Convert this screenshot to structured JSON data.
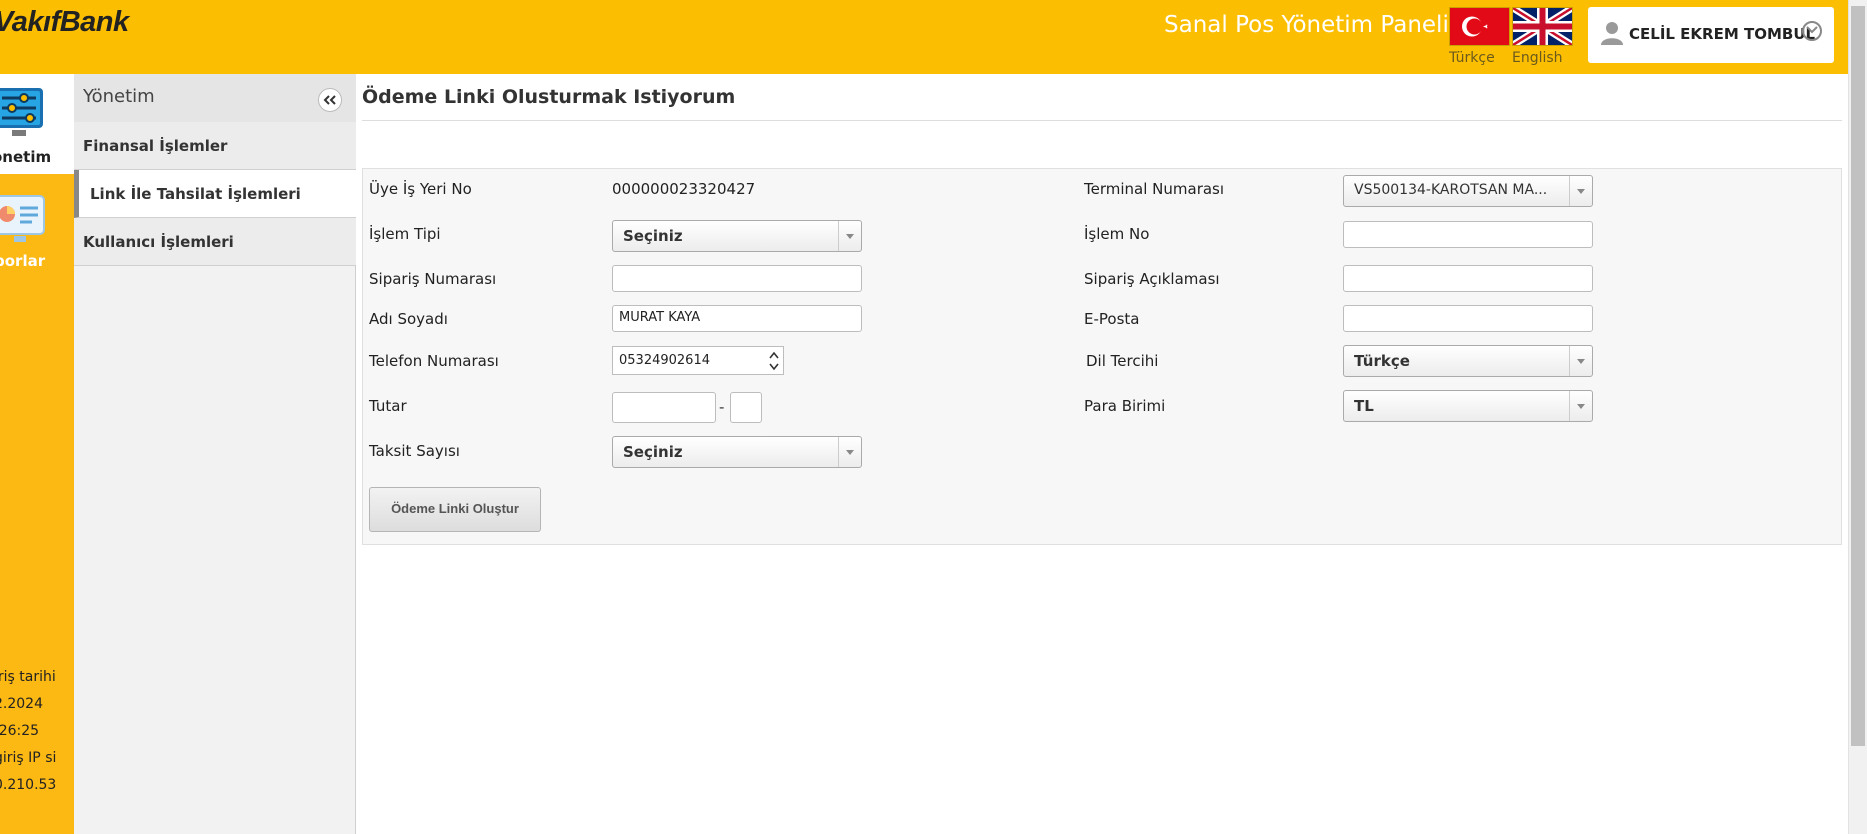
{
  "header": {
    "logo": "VakıfBank",
    "panel_title": "Sanal Pos Yönetim Paneli",
    "lang_tr": "Türkçe",
    "lang_en": "English",
    "user_name": "CELİL EKREM TOMBUL",
    "accent_color": "#fcbe00"
  },
  "rail": {
    "items": [
      {
        "label": "önetim",
        "icon": "settings-sliders-icon"
      },
      {
        "label": "porlar",
        "icon": "reports-icon"
      }
    ],
    "info_lines": [
      "iriş tarihi",
      "2.2024",
      ":26:25",
      "giriş IP si",
      "0.210.53"
    ]
  },
  "subnav": {
    "title": "Yönetim",
    "items": [
      {
        "label": "Finansal İşlemler",
        "active": false
      },
      {
        "label": "Link İle Tahsilat İşlemleri",
        "active": true
      },
      {
        "label": "Kullanıcı İşlemleri",
        "active": false
      }
    ]
  },
  "page": {
    "title": "Ödeme Linki Olusturmak Istiyorum"
  },
  "form": {
    "uye_is_yeri_no_label": "Üye İş Yeri No",
    "uye_is_yeri_no_value": "000000023320427",
    "terminal_label": "Terminal Numarası",
    "terminal_value": "VS500134-KAROTSAN MA...",
    "islem_tipi_label": "İşlem Tipi",
    "islem_tipi_value": "Seçiniz",
    "islem_no_label": "İşlem No",
    "islem_no_value": "",
    "siparis_no_label": "Sipariş Numarası",
    "siparis_no_value": "",
    "siparis_aciklama_label": "Sipariş Açıklaması",
    "siparis_aciklama_value": "",
    "adi_soyadi_label": "Adı Soyadı",
    "adi_soyadi_value": "MURAT KAYA",
    "eposta_label": "E-Posta",
    "eposta_value": "",
    "telefon_label": "Telefon Numarası",
    "telefon_value": "05324902614",
    "dil_label": "Dil Tercihi",
    "dil_value": "Türkçe",
    "tutar_label": "Tutar",
    "tutar_separator": "-",
    "tutar_main_value": "",
    "tutar_cents_value": "",
    "para_birimi_label": "Para Birimi",
    "para_birimi_value": "TL",
    "taksit_label": "Taksit Sayısı",
    "taksit_value": "Seçiniz",
    "submit_label": "Ödeme Linki Oluştur"
  }
}
